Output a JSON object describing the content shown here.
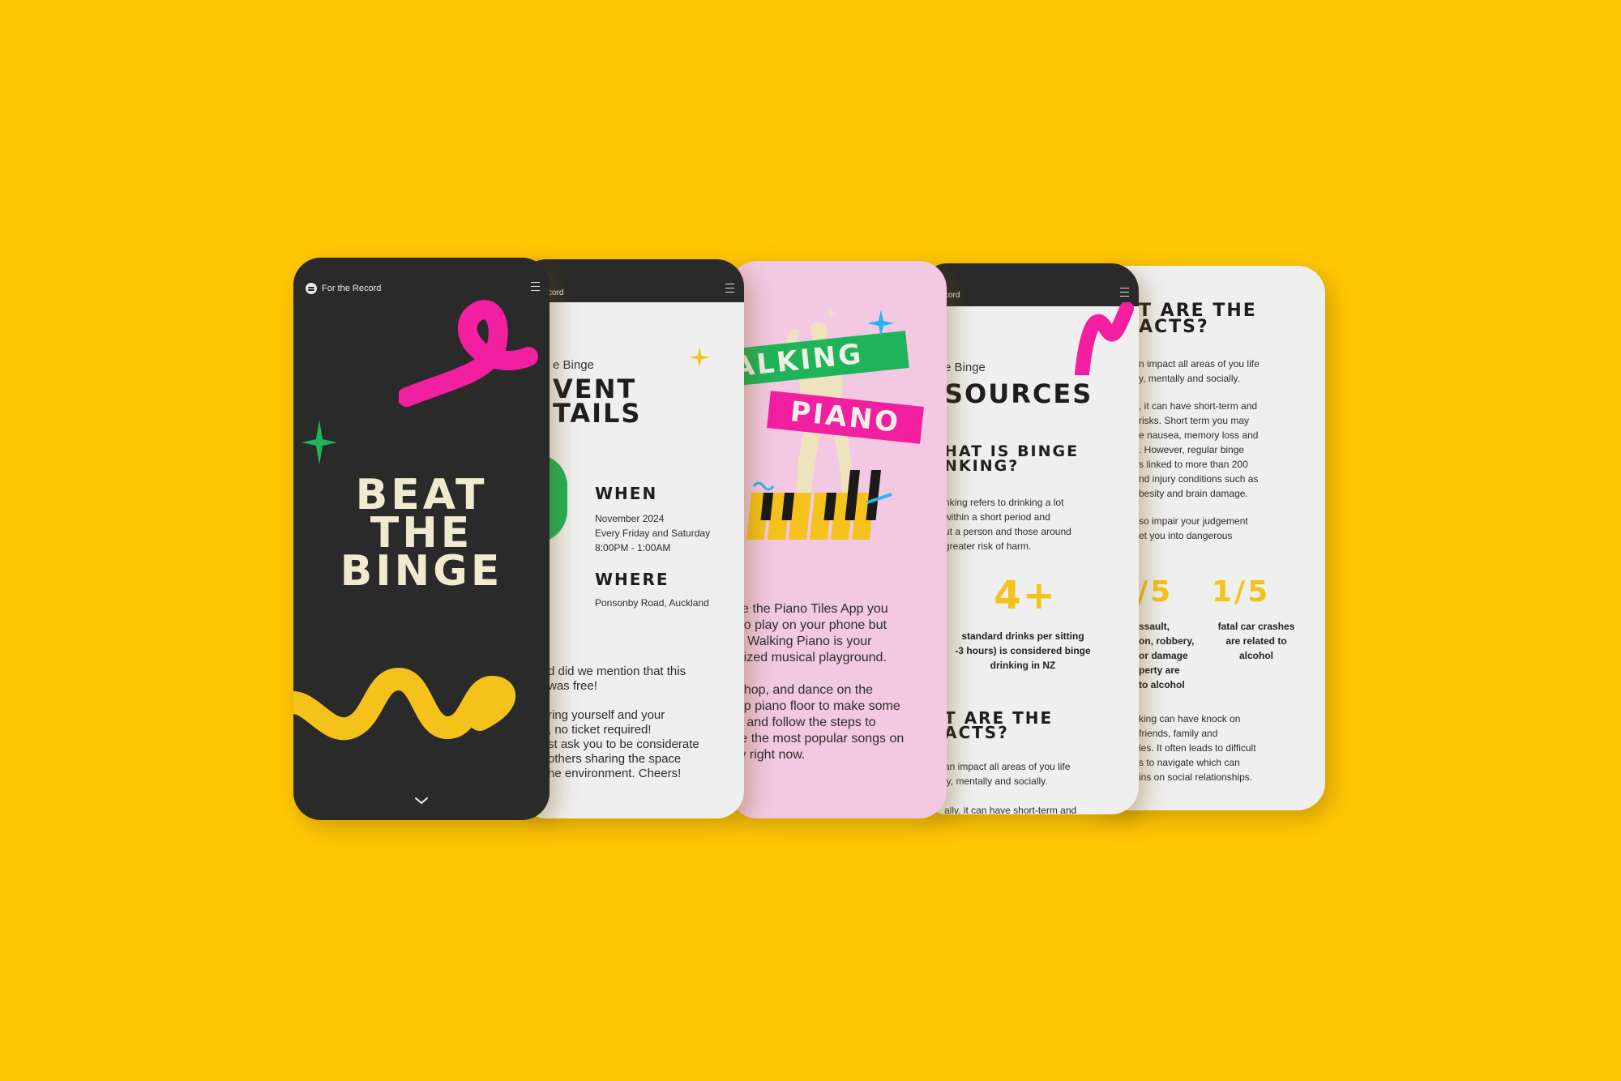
{
  "brand": {
    "name": "For the Record",
    "name_partial": "cord"
  },
  "colors": {
    "background": "#FFC805",
    "dark": "#2a2a2a",
    "pink": "#F21FA0",
    "green": "#1FB35A",
    "yellow": "#F4C21B",
    "light_pink": "#F2C8E2"
  },
  "screen1": {
    "title_lines": [
      "BEAT",
      "THE",
      "BINGE"
    ],
    "icons": [
      "spotify-logo-icon",
      "menu-icon",
      "chevron-down-icon",
      "sparkle-icon"
    ]
  },
  "screen2": {
    "eyebrow": "e Binge",
    "heading_lines": [
      "VENT",
      "TAILS"
    ],
    "when_label": "WHEN",
    "when_lines": [
      "November 2024",
      "Every Friday and Saturday",
      "8:00PM - 1:00AM"
    ],
    "where_label": "WHERE",
    "where_value": "Ponsonby Road, Auckland",
    "body_lines": [
      "d did we mention that this",
      "was free!",
      "",
      "ring yourself and your",
      ", no ticket required!",
      "st ask you to be considerate",
      " others sharing the space",
      "he environment. Cheers!"
    ]
  },
  "screen3": {
    "banner_1": "ALKING",
    "banner_2": "PIANO",
    "body_lines": [
      " like the Piano Tiles App you",
      "d to play on your phone but",
      "er. Walking Piano is your",
      "t-sized musical playground.",
      "",
      "p, hop, and dance on the",
      "t up piano floor to make some",
      "es and follow the steps to",
      "ate the most popular songs on",
      "tify right now."
    ]
  },
  "screen4": {
    "eyebrow": "e Binge",
    "heading": "SOURCES",
    "subheading_lines": [
      "HAT IS BINGE",
      "NKING?"
    ],
    "body_lines": [
      "nking refers to drinking a lot",
      " within a short period and",
      "ut a person and those around",
      " greater risk of harm."
    ],
    "stat": "4+",
    "stat_caption_lines": [
      "standard drinks per sitting",
      "-3 hours) is considered binge",
      "drinking in NZ"
    ],
    "facts_heading_lines": [
      "T ARE THE",
      "ACTS?"
    ],
    "facts_lines": [
      "an impact all areas of you life",
      "ly, mentally and socially.",
      "",
      "ally, it can have short-term and"
    ]
  },
  "screen5": {
    "heading_lines": [
      "T ARE THE",
      "ACTS?"
    ],
    "para1_lines": [
      "n impact all areas of you life",
      "y, mentally and socially."
    ],
    "para2_lines": [
      ", it can have short-term and",
      " risks. Short term you may",
      "e nausea, memory loss and",
      ". However, regular binge",
      "s linked to more than 200",
      "nd injury conditions such as",
      "besity and brain damage."
    ],
    "para3_lines": [
      "so impair your judgement",
      "et you into dangerous"
    ],
    "stat_a": "/5",
    "stat_a_caption_lines": [
      "ssault,",
      "on, robbery,",
      " or damage",
      "perty are",
      " to alcohol"
    ],
    "stat_b": "1/5",
    "stat_b_caption_lines": [
      "fatal car crashes",
      "are related to",
      "alcohol"
    ],
    "para4_lines": [
      "king can have knock on",
      "friends, family and",
      "ies. It often leads to difficult",
      "s to navigate which can",
      "ins on social relationships."
    ]
  }
}
